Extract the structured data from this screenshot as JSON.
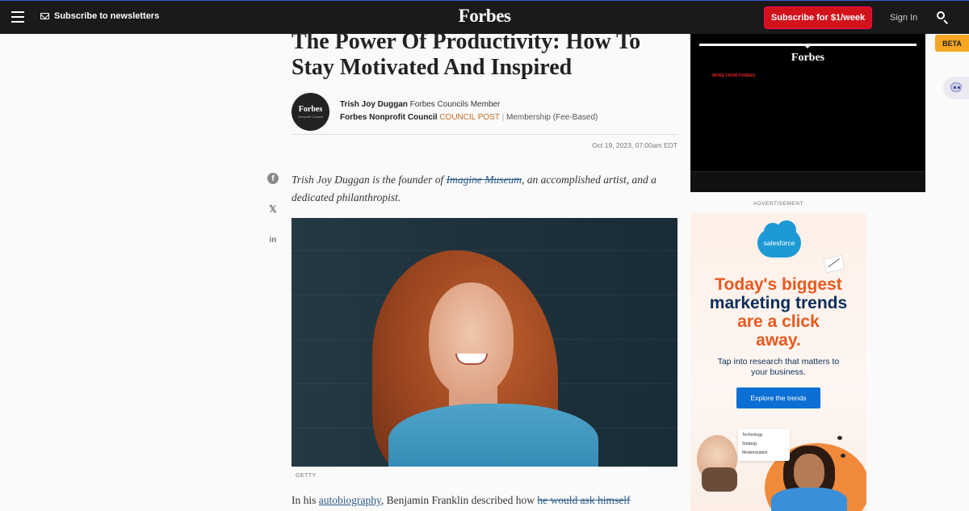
{
  "header": {
    "menu_icon": "hamburger-menu-icon",
    "newsletter_label": "Subscribe to newsletters",
    "logo": "Forbes",
    "subscribe_label": "Subscribe for $1/week",
    "signin_label": "Sign In",
    "search_icon": "search-icon",
    "bg_color": "#1a1a1a",
    "subscribe_color": "#d2121b"
  },
  "article": {
    "headline": "The Power Of Productivity: How To Stay Motivated And Inspired",
    "avatar_text": "Forbes",
    "avatar_subtext": "Nonprofit Council",
    "author_name": "Trish Joy Duggan",
    "author_role": "Forbes Councils Member",
    "council_name": "Forbes Nonprofit Council",
    "council_post": "COUNCIL POST",
    "separator": "|",
    "membership": "Membership (Fee-Based)",
    "date": "Oct 19, 2023, 07:00am EDT",
    "intro_before": "Trish Joy Duggan is the founder of ",
    "intro_link": "Imagine Museum",
    "intro_after": ", an accomplished artist, and a dedicated philanthropist.",
    "photo_credit": "GETTY",
    "body_before": "In his ",
    "body_link1": "autobiography",
    "body_middle": ", Benjamin Franklin described how ",
    "body_link2": "he would ask himself"
  },
  "share": {
    "facebook": "f",
    "x": "𝕏",
    "linkedin": "in"
  },
  "video": {
    "logo": "Forbes",
    "more_label": "MORE FROM FORBES"
  },
  "beta_label": "BETA",
  "ad": {
    "label": "ADVERTISEMENT",
    "brand": "salesforce",
    "headline_orange1": "Today's biggest",
    "headline_navy1": "marketing trends",
    "headline_orange2": "are a click",
    "headline_orange3": "away.",
    "subtext": "Tap into research that matters to your business.",
    "button_label": "Explore the trends",
    "card_items": [
      "Technology",
      "Strategy",
      "Modernization"
    ],
    "accent_orange": "#e8591f",
    "accent_navy": "#0b2e58"
  }
}
